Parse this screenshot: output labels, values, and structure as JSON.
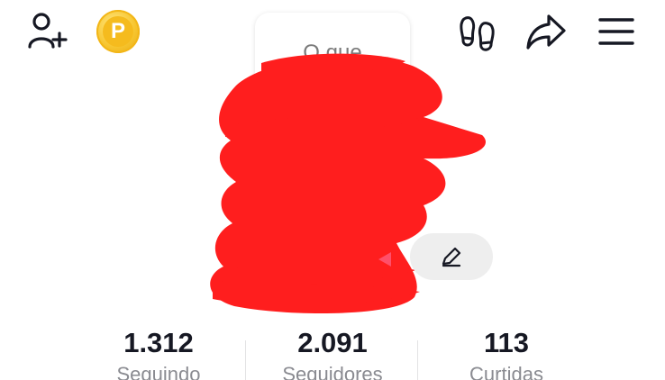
{
  "header": {
    "add_friend_icon": "person-plus-icon",
    "coin_icon": "coin-icon",
    "coin_label": "P",
    "profile_views_icon": "footprints-icon",
    "share_icon": "share-arrow-icon",
    "menu_icon": "hamburger-menu-icon"
  },
  "story": {
    "prompt_text": "O que"
  },
  "profile": {
    "edit_icon": "pencil-icon"
  },
  "stats": [
    {
      "value": "1.312",
      "label": "Seguindo"
    },
    {
      "value": "2.091",
      "label": "Seguidores"
    },
    {
      "value": "113",
      "label": "Curtidas"
    }
  ],
  "colors": {
    "coin_gold": "#f5bb1e",
    "redaction_red": "#ff1e1e",
    "stat_value": "#161823",
    "stat_label": "#8a8b91",
    "edit_pill_bg": "#eeeeee"
  }
}
